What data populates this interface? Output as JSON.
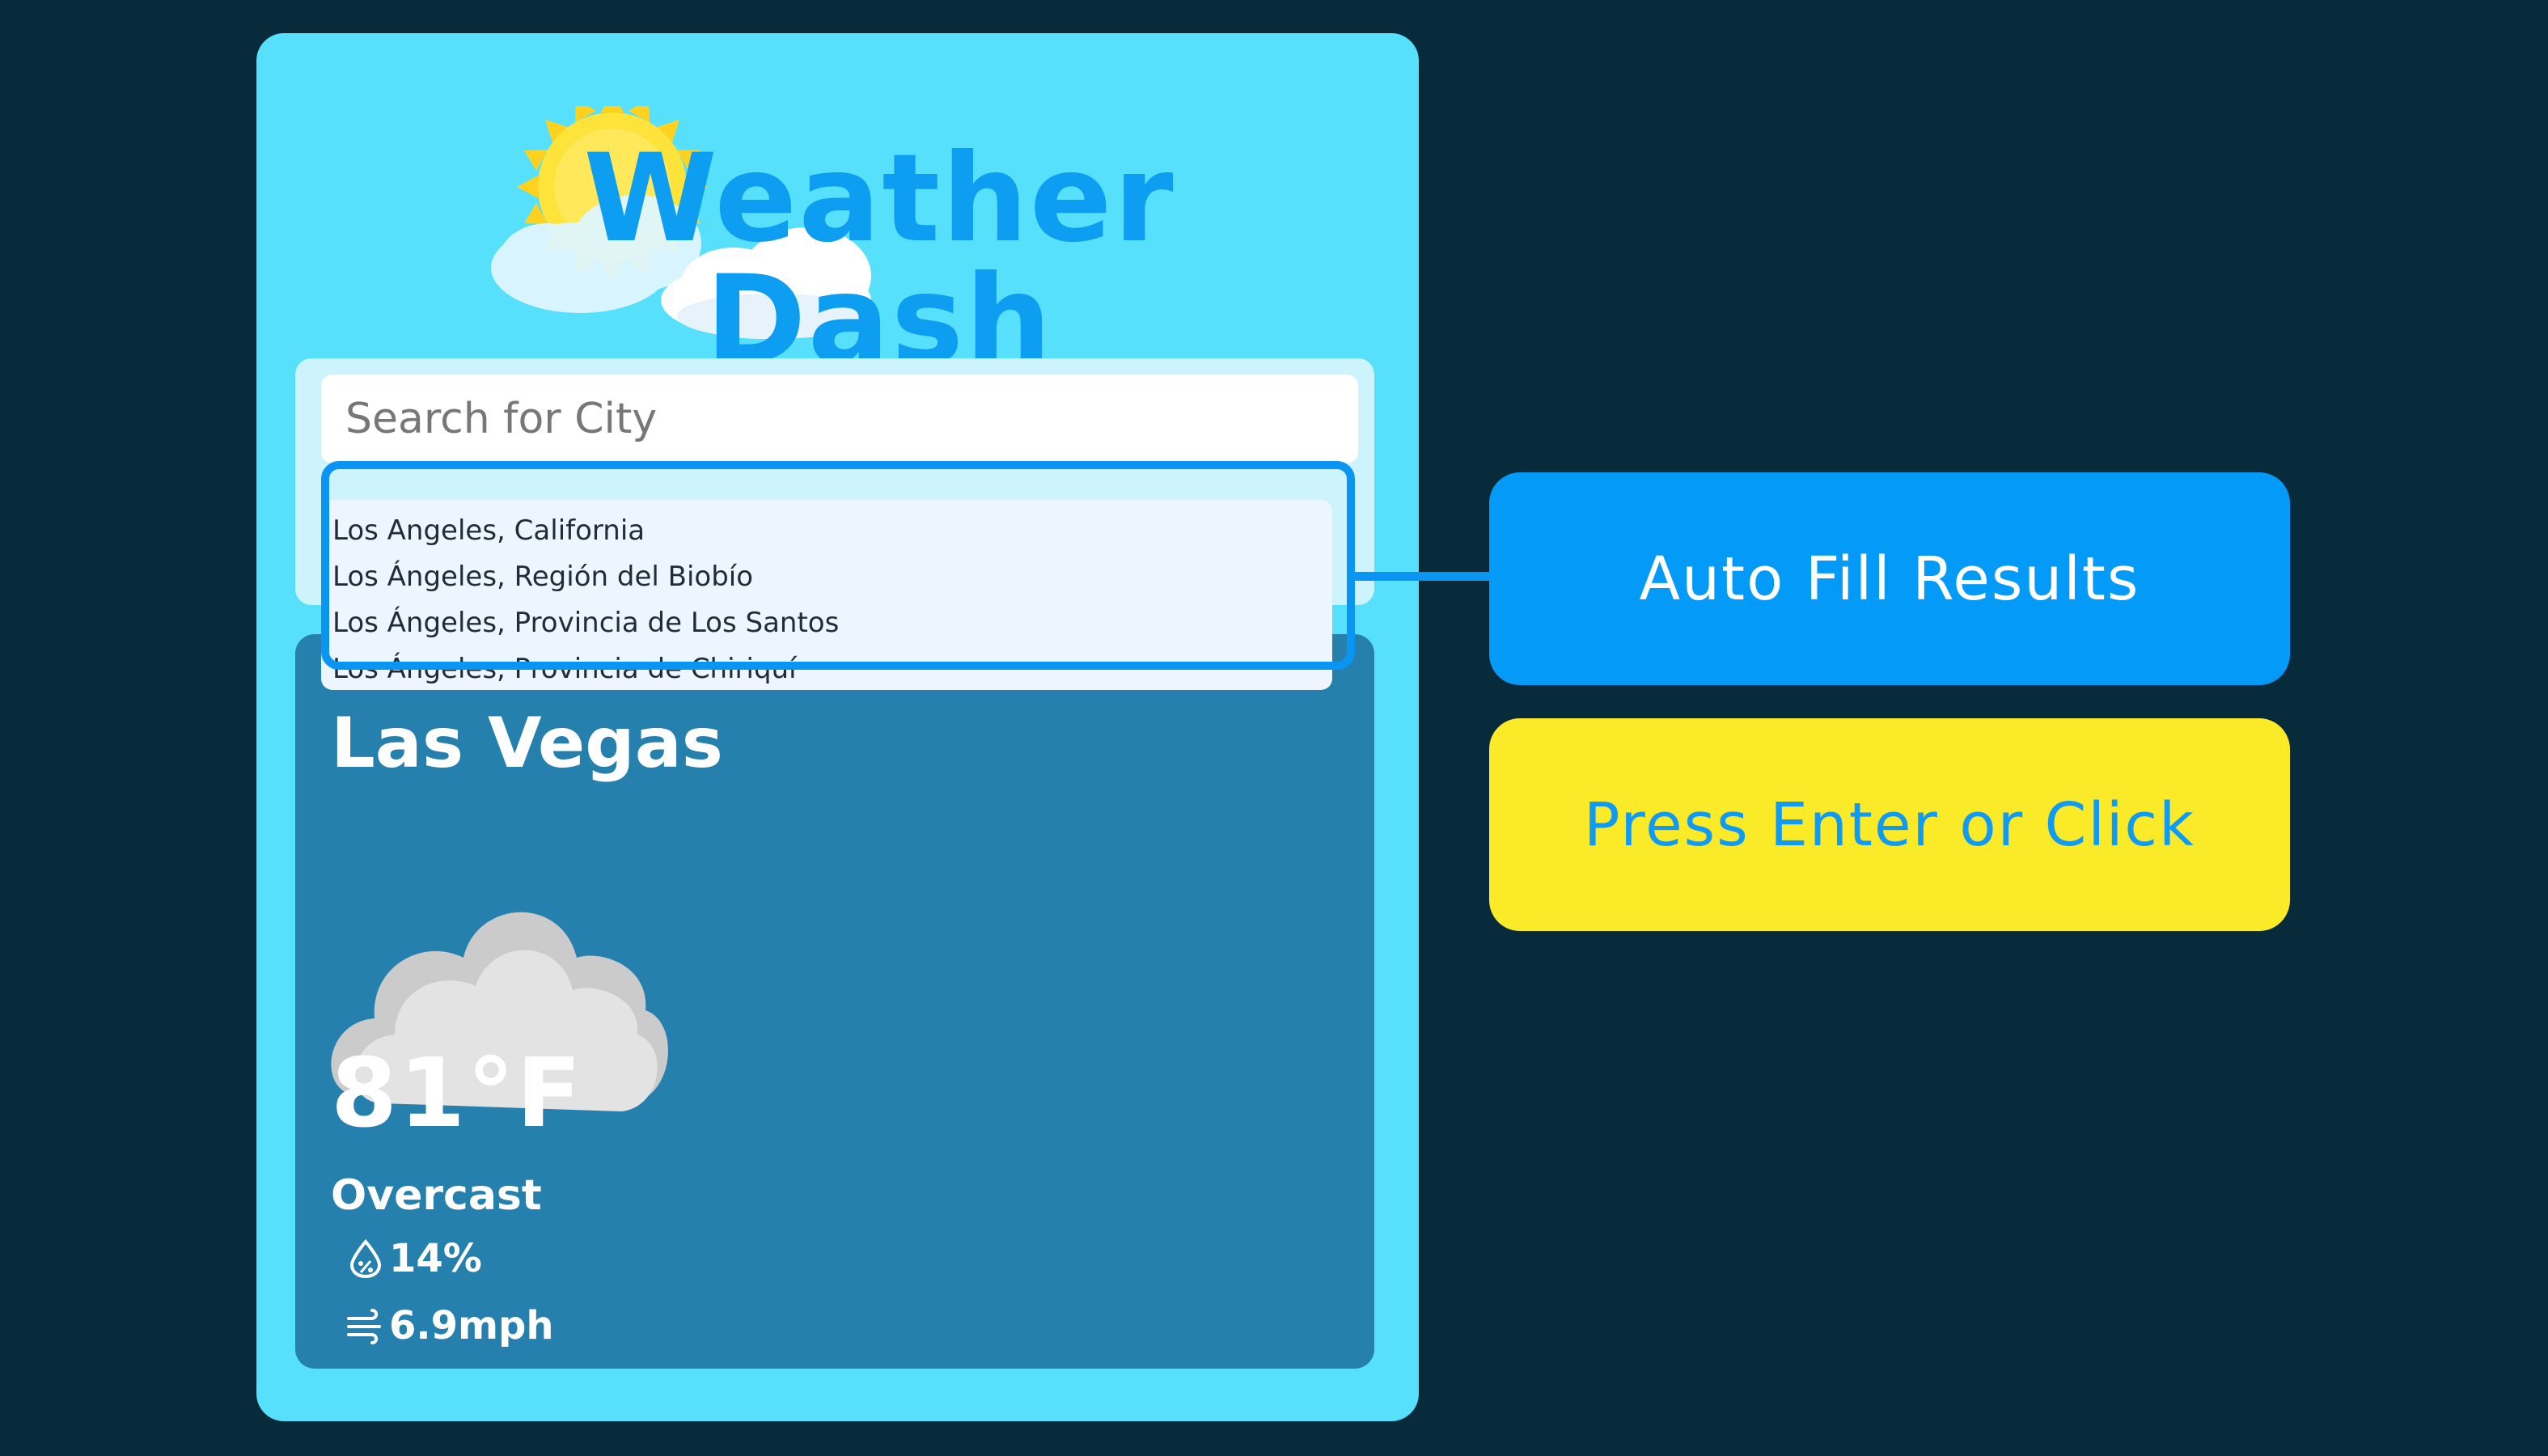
{
  "app": {
    "title": "Weather Dash"
  },
  "search": {
    "placeholder": "Search for City",
    "value": "",
    "suggestions": [
      "Los Angeles, California",
      "Los Ángeles, Región del Biobío",
      "Los Ángeles, Provincia de Los Santos",
      "Los Ángeles, Provincia de Chiriquí"
    ]
  },
  "weather": {
    "city": "Las Vegas",
    "icon": "overcast-cloud-icon",
    "temperature": "81°F",
    "condition": "Overcast",
    "humidity": "14%",
    "wind": "6.9mph"
  },
  "callouts": {
    "autofill": "Auto Fill Results",
    "enter": "Press Enter or Click"
  },
  "colors": {
    "background": "#082b3c",
    "app_card": "#57e0fc",
    "title": "#0d9ef1",
    "weather_card": "#2680ad",
    "highlight": "#0b95f2",
    "callout_blue": "#039af8",
    "callout_yellow": "#fbea27"
  }
}
